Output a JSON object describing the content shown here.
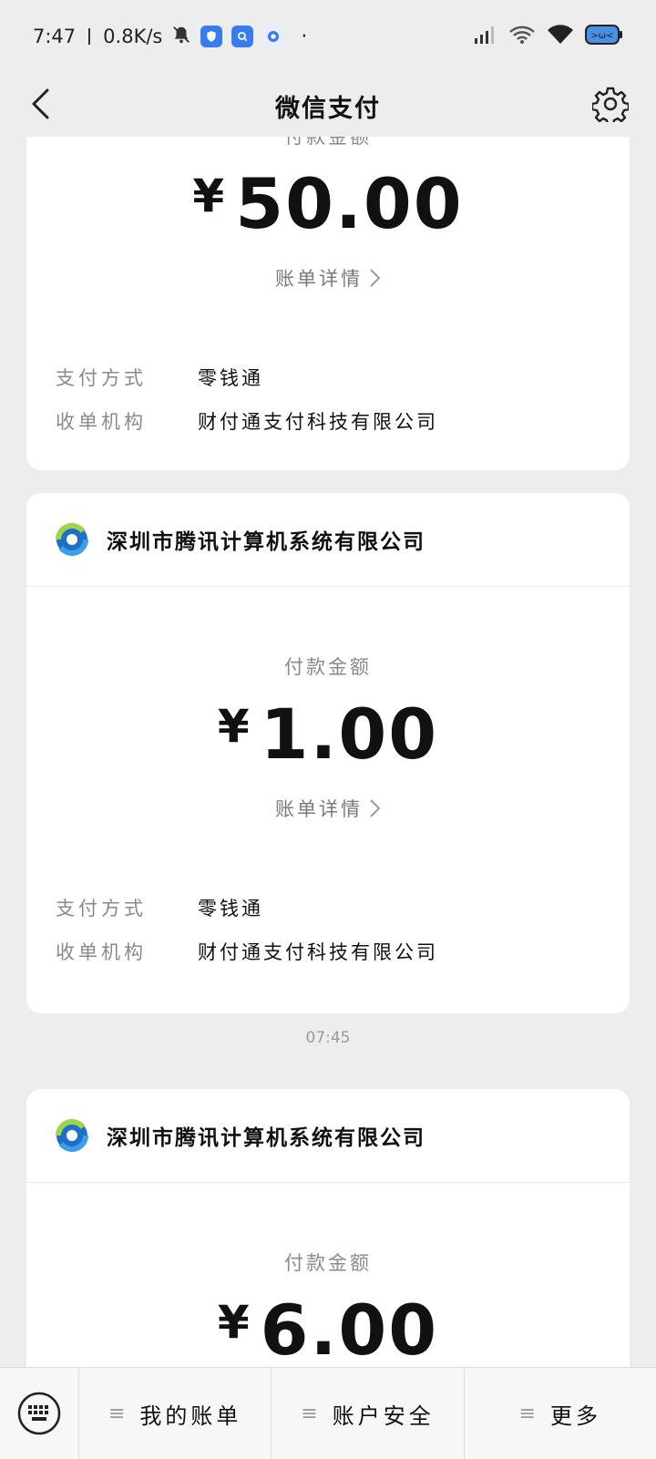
{
  "status_bar": {
    "time": "7:47",
    "net_speed": "0.8K/s"
  },
  "nav": {
    "title": "微信支付"
  },
  "cards": [
    {
      "amount_label": "付款金额",
      "currency": "¥",
      "amount": "50.00",
      "details_link": "账单详情",
      "info": [
        {
          "key": "支付方式",
          "value": "零钱通"
        },
        {
          "key": "收单机构",
          "value": "财付通支付科技有限公司"
        }
      ]
    },
    {
      "merchant": "深圳市腾讯计算机系统有限公司",
      "amount_label": "付款金额",
      "currency": "¥",
      "amount": "1.00",
      "details_link": "账单详情",
      "info": [
        {
          "key": "支付方式",
          "value": "零钱通"
        },
        {
          "key": "收单机构",
          "value": "财付通支付科技有限公司"
        }
      ]
    },
    {
      "merchant": "深圳市腾讯计算机系统有限公司",
      "amount_label": "付款金额",
      "currency": "¥",
      "amount": "6.00"
    }
  ],
  "timestamp": "07:45",
  "bottom_tabs": [
    {
      "label": "我的账单"
    },
    {
      "label": "账户安全"
    },
    {
      "label": "更多"
    }
  ]
}
